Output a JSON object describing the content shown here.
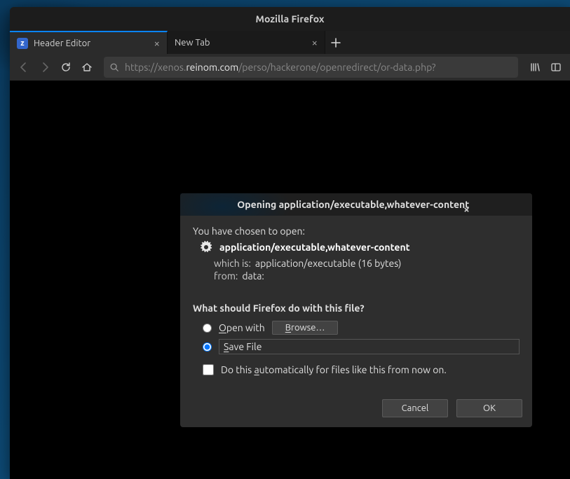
{
  "window": {
    "title": "Mozilla Firefox"
  },
  "tabs": [
    {
      "label": "Header Editor",
      "favicon_color": "#3366cc"
    },
    {
      "label": "New Tab",
      "favicon_color": ""
    }
  ],
  "url": {
    "prefix": "https://xenos.",
    "highlight": "reinom.com",
    "suffix": "/perso/hackerone/openredirect/or-data.php?"
  },
  "dialog": {
    "title": "Opening application/executable,whatever-content",
    "intro": "You have chosen to open:",
    "filename": "application/executable,whatever-content",
    "which_is_label": "which is:",
    "which_is_value": "application/executable (16 bytes)",
    "from_label": "from:",
    "from_value": "data:",
    "question": "What should Firefox do with this file?",
    "open_with": "Open with",
    "browse": "Browse…",
    "save_file": "Save File",
    "auto": "Do this automatically for files like this from now on.",
    "cancel": "Cancel",
    "ok": "OK"
  }
}
